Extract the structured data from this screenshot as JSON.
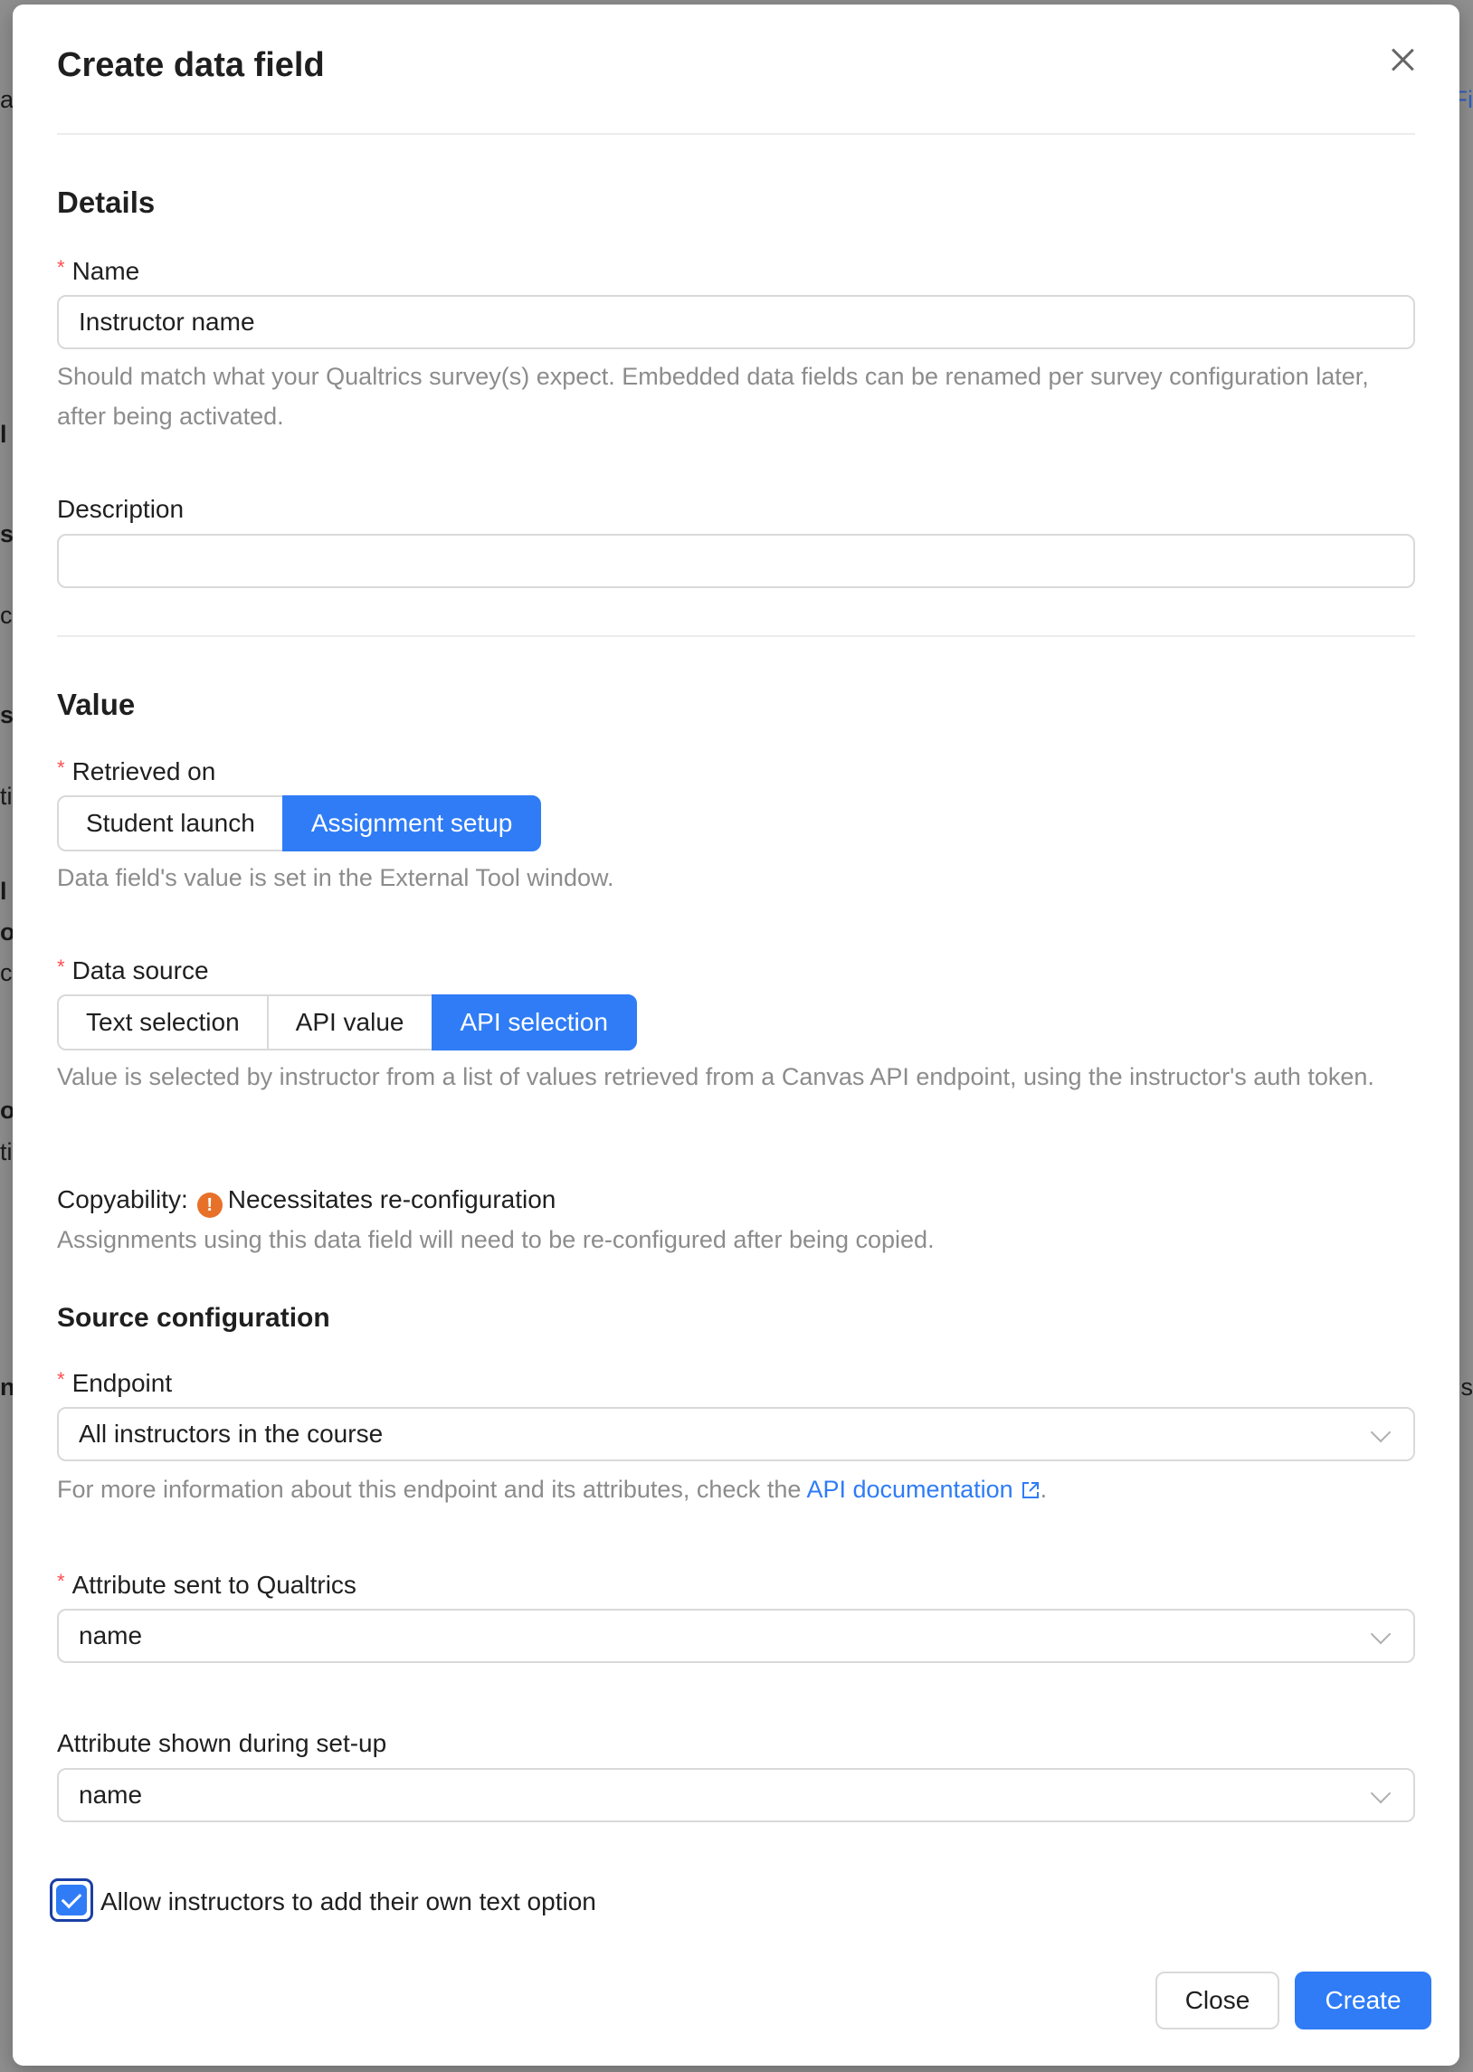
{
  "modal": {
    "title": "Create data field"
  },
  "details": {
    "heading": "Details",
    "name_label": "Name",
    "name_value": "Instructor name",
    "name_help": "Should match what your Qualtrics survey(s) expect. Embedded data fields can be renamed per survey configuration later, after being activated.",
    "description_label": "Description",
    "description_value": ""
  },
  "value": {
    "heading": "Value",
    "retrieved_label": "Retrieved on",
    "retrieved_options": [
      "Student launch",
      "Assignment setup"
    ],
    "retrieved_selected": "Assignment setup",
    "retrieved_help": "Data field's value is set in the External Tool window.",
    "source_label": "Data source",
    "source_options": [
      "Text selection",
      "API value",
      "API selection"
    ],
    "source_selected": "API selection",
    "source_help": "Value is selected by instructor from a list of values retrieved from a Canvas API endpoint, using the instructor's auth token.",
    "copyability_label": "Copyability:",
    "copyability_icon": "warning-circle-icon",
    "copyability_value": "Necessitates re-configuration",
    "copyability_help": "Assignments using this data field will need to be re-configured after being copied."
  },
  "source_config": {
    "heading": "Source configuration",
    "endpoint_label": "Endpoint",
    "endpoint_value": "All instructors in the course",
    "endpoint_help_prefix": "For more information about this endpoint and its attributes, check the ",
    "endpoint_help_link": "API documentation",
    "endpoint_help_suffix": ".",
    "attr_sent_label": "Attribute sent to Qualtrics",
    "attr_sent_value": "name",
    "attr_shown_label": "Attribute shown during set-up",
    "attr_shown_value": "name",
    "allow_text_label": "Allow instructors to add their own text option",
    "allow_text_checked": true
  },
  "footer": {
    "close_label": "Close",
    "create_label": "Create"
  },
  "colors": {
    "primary": "#2f7cf6",
    "required": "#ff4d4f",
    "warning": "#e8712a"
  }
}
